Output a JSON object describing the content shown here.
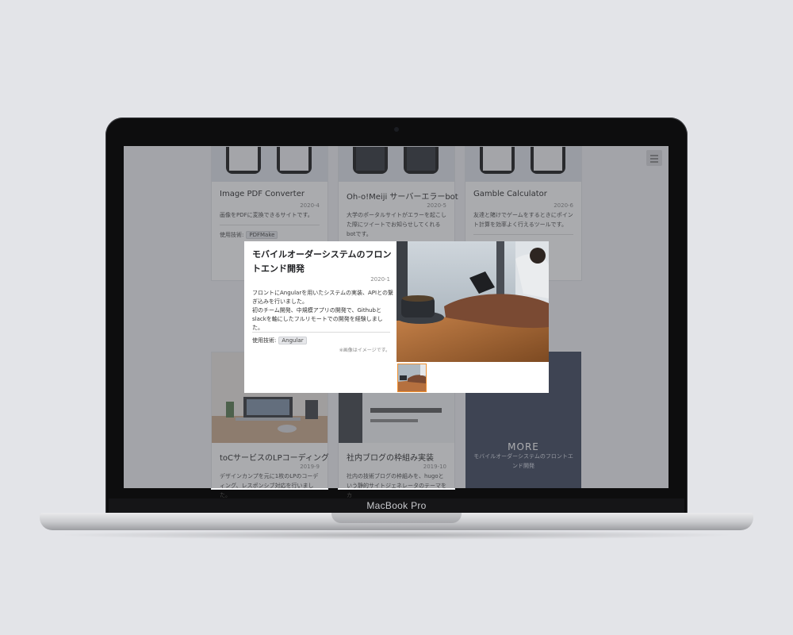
{
  "device": {
    "label": "MacBook Pro"
  },
  "cards": [
    {
      "title": "Image PDF Converter",
      "date": "2020-4",
      "desc": "画像をPDFに変換できるサイトです。",
      "tech_label": "使用技術:",
      "tags": [
        "PDFMake"
      ]
    },
    {
      "title": "Oh-o!Meiji サーバーエラーbot",
      "date": "2020-5",
      "desc": "大学のポータルサイトがエラーを起こした際にツイートでお知らせしてくれるbotです。"
    },
    {
      "title": "Gamble Calculator",
      "date": "2020-6",
      "desc": "友達と賭けでゲームをするときにポイント計算を効率よく行えるツールです。"
    },
    {
      "title": "toCサービスのLPコーディング",
      "date": "2019-9",
      "desc": "デザインカンプを元に1枚のLPのコーディング、レスポンシブ対応を行いました。"
    },
    {
      "title": "社内ブログの枠組み実装",
      "date": "2019-10",
      "desc": "社内の技術ブログの枠組みを、hugoという静的サイトジェネレータのテーマをカ"
    }
  ],
  "more": {
    "label": "MORE",
    "sub": "モバイルオーダーシステムのフロントエンド開発"
  },
  "modal": {
    "title": "モバイルオーダーシステムのフロントエンド開発",
    "date": "2020-1",
    "desc_lines": [
      "フロントにAngularを用いたシステムの実装、APIとの繋ぎ込みを行いました。",
      "初のチーム開発、中規模アプリの開発で、Githubとslackを軸にしたフルリモートでの開発を経験しました。"
    ],
    "tech_label": "使用技術:",
    "tags": [
      "Angular"
    ],
    "note": "※画像はイメージです。"
  }
}
